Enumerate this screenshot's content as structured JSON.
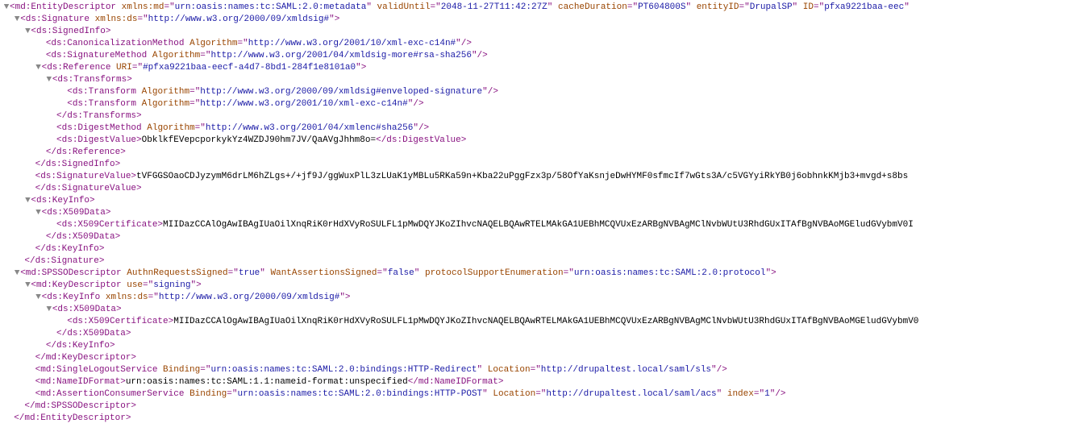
{
  "entity": {
    "xmlns_md": "urn:oasis:names:tc:SAML:2.0:metadata",
    "validUntil": "2048-11-27T11:42:27Z",
    "cacheDuration": "PT604800S",
    "entityID": "DrupalSP",
    "ID": "pfxa9221baa-eec"
  },
  "sig": {
    "xmlns_ds": "http://www.w3.org/2000/09/xmldsig#"
  },
  "canon": {
    "alg": "http://www.w3.org/2001/10/xml-exc-c14n#"
  },
  "sigMethod": {
    "alg": "http://www.w3.org/2001/04/xmldsig-more#rsa-sha256"
  },
  "ref": {
    "uri": "#pfxa9221baa-eecf-a4d7-8bd1-284f1e8101a0"
  },
  "tr1": {
    "alg": "http://www.w3.org/2000/09/xmldsig#enveloped-signature"
  },
  "tr2": {
    "alg": "http://www.w3.org/2001/10/xml-exc-c14n#"
  },
  "dm": {
    "alg": "http://www.w3.org/2001/04/xmlenc#sha256"
  },
  "digest": "ObklkfEVepcporkykYz4WZDJ90hm7JV/QaAVgJhhm8o=",
  "sigval": "tVFGGSOaoCDJyzymM6drLM6hZLgs+/+jf9J/ggWuxPlL3zLUaK1yMBLu5RKa59n+Kba22uPggFzx3p/58OfYaKsnjeDwHYMF0sfmcIf7wGts3A/c5VGYyiRkYB0j6obhnkKMjb3+mvgd+s8bs",
  "cert1": "MIIDazCCAlOgAwIBAgIUaOilXnqRiK0rHdXVyRoSULFL1pMwDQYJKoZIhvcNAQELBQAwRTELMAkGA1UEBhMCQVUxEzARBgNVBAgMClNvbWUtU3RhdGUxITAfBgNVBAoMGEludGVybmV0I",
  "sps": {
    "ars": "true",
    "was": "false",
    "pse": "urn:oasis:names:tc:SAML:2.0:protocol"
  },
  "kd": {
    "use": "signing"
  },
  "ki": {
    "xmlns_ds": "http://www.w3.org/2000/09/xmldsig#"
  },
  "cert2": "MIIDazCCAlOgAwIBAgIUaOilXnqRiK0rHdXVyRoSULFL1pMwDQYJKoZIhvcNAQELBQAwRTELMAkGA1UEBhMCQVUxEzARBgNVBAgMClNvbWUtU3RhdGUxITAfBgNVBAoMGEludGVybmV0",
  "slo": {
    "bind": "urn:oasis:names:tc:SAML:2.0:bindings:HTTP-Redirect",
    "loc": "http://drupaltest.local/saml/sls"
  },
  "nid": "urn:oasis:names:tc:SAML:1.1:nameid-format:unspecified",
  "acs": {
    "bind": "urn:oasis:names:tc:SAML:2.0:bindings:HTTP-POST",
    "loc": "http://drupaltest.local/saml/acs",
    "idx": "1"
  }
}
